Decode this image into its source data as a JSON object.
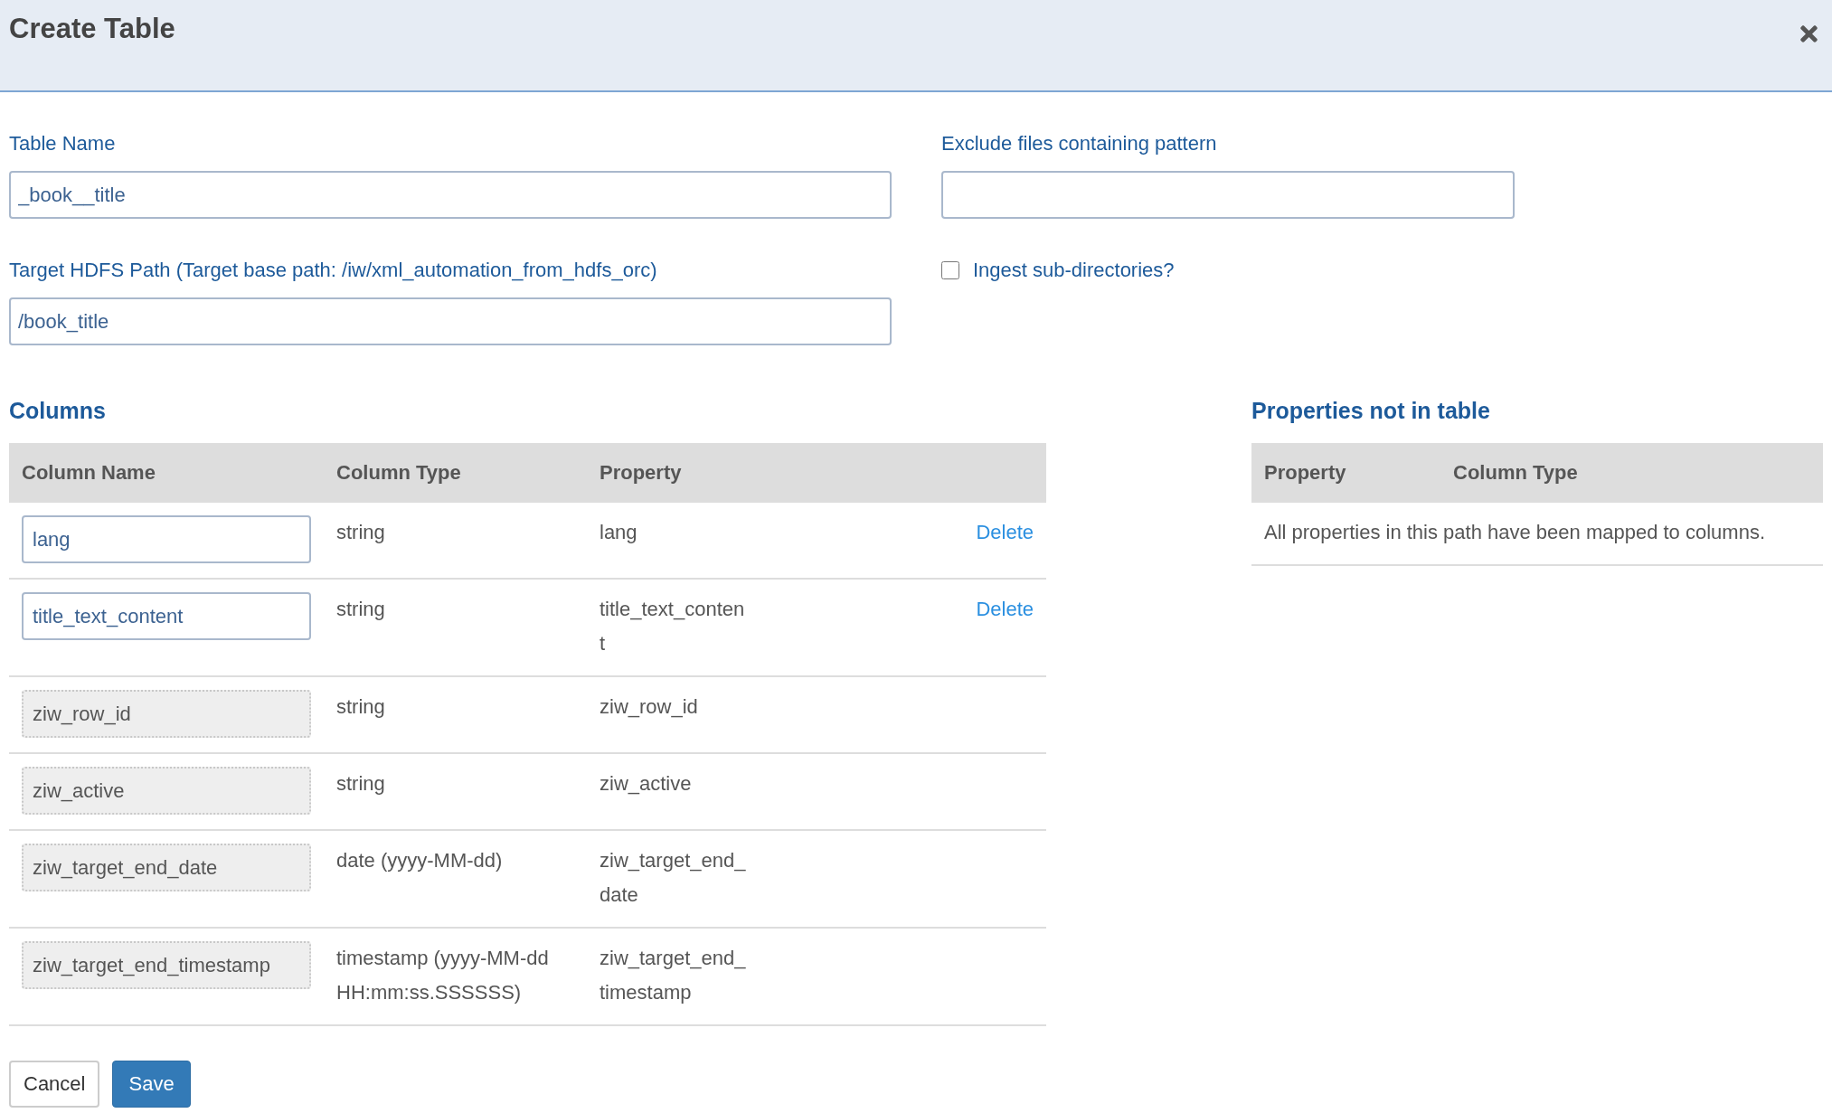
{
  "dialog": {
    "title": "Create Table"
  },
  "form": {
    "table_name": {
      "label": "Table Name",
      "value": "_book__title"
    },
    "exclude_pattern": {
      "label": "Exclude files containing pattern"
    },
    "target_path": {
      "label": "Target HDFS Path (Target base path: /iw/xml_automation_from_hdfs_orc)",
      "value": "/book_title"
    },
    "ingest_subdirectories": {
      "label": "Ingest sub-directories?",
      "checked": false
    }
  },
  "columns": {
    "heading": "Columns",
    "headers": [
      "Column Name",
      "Column Type",
      "Property"
    ],
    "rows": [
      {
        "name": "lang",
        "type": "string",
        "property": "lang",
        "disabled": false,
        "action": "Delete"
      },
      {
        "name": "title_text_content",
        "type": "string",
        "property": "title_text_content",
        "disabled": false,
        "action": "Delete"
      },
      {
        "name": "ziw_row_id",
        "type": "string",
        "property": "ziw_row_id",
        "disabled": true
      },
      {
        "name": "ziw_active",
        "type": "string",
        "property": "ziw_active",
        "disabled": true
      },
      {
        "name": "ziw_target_end_date",
        "type": "date (yyyy-MM-dd)",
        "property": "ziw_target_end_date",
        "disabled": true
      },
      {
        "name": "ziw_target_end_timestamp",
        "type": "timestamp (yyyy-MM-dd HH:mm:ss.SSSSSS)",
        "property": "ziw_target_end_timestamp",
        "disabled": true
      }
    ]
  },
  "properties_not_in_table": {
    "heading": "Properties not in table",
    "headers": [
      "Property",
      "Column Type"
    ],
    "empty_message": "All properties in this path have been mapped to columns."
  },
  "buttons": [
    {
      "label": "Cancel",
      "kind": "default"
    },
    {
      "label": "Save",
      "kind": "primary"
    }
  ]
}
